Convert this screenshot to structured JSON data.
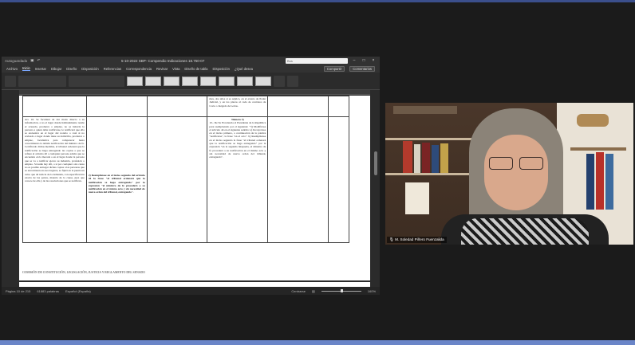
{
  "word": {
    "autosave": "Autoguardado",
    "doc_title": "5-10-2022 SBP- Compendio Indicaciones 18.750-07",
    "search_placeholder": "Bus",
    "menu_tabs": [
      "Archivo",
      "Inicio",
      "Insertar",
      "Dibujar",
      "Diseño",
      "Disposición",
      "Referencias",
      "Correspondencia",
      "Revisar",
      "Vista",
      "Diseño de tabla",
      "Disposición",
      "¿Qué desea"
    ],
    "menu_right": [
      "Compartir",
      "Comentarios"
    ],
    "table": {
      "row1": {
        "c3": "mes, dos años si es séptica, en el evento de Poder Judicial, y en los plazos al cada de contratos de Corte o Juzgado de Letras."
      },
      "row2": {
        "c1": "Art. 16. Se facultará de dar modo directo a su información, a no el lugar donde habitualmente reside el acusado, produzca o emplee, no se haberle la persona a quien debe notificarse, le notificará que ella se encuentra en el lugar del notario o cual si no revisado o lugar donde tiene su domicilio, produzca o emplee, facultativa para comparecer hasta conocimiento la debida notificación del ministro de fe. Certificado dichas medidas, el tribunal ordenará que la notificación se haga entregando las copias a que se refiere el artículo 40 a cualquier persona adulta que se encuentre en la morada o en el lugar donde la persona que se va a notificar ejerce su industria, profesión o empleo. Si nadie hay allí, o si por cualquier otra causa no es posible entregar dichas copias a las personas que se encontraren en esos lugares, se fijará en la puerta un aviso que dé noticia de la demanda, con especificación exacta de las partes, materia de la causa, juez que conoce de ella y de las resoluciones que se notifican.",
        "c2": "2) Reemplázase en el inciso segundo del artículo 44 la frase \"el tribunal ordenará que la notificación se haga entregando\" por la expresión \"el ministro de fe procederá a su notificación en el mismo acto y sin necesidad de nueva orden del tribunal, entregando\".",
        "c3_heading": "Número 3)",
        "c3": "10.- De Su Excelencia el Presidente de la República para reemplazarlo por el siguiente: \"3) Modifícase el artículo 44 en el siguiente sentido: a) Incorpórase en el inciso primero, a continuación de la palabra \"notificarse\", la frase \"en el acto\". b) Reemplázase en el inciso segundo la frase \"el tribunal ordenará que la notificación se haga entregando\" por la expresión \"en la segunda búsqueda, el ministro de fe procederá a su notificación en el mismo acto y sin necesidad de nueva orden del tribunal, entregando\"."
      }
    },
    "footer_note": "COMISIÓN DE CONSTITUCIÓN, LEGISLACIÓN, JUSTICIA Y REGLAMENTO DEL SENADO",
    "status": {
      "page": "Página 10 de 215",
      "words": "61883 palabras",
      "language": "Español (España)",
      "focus": "Centrarse",
      "zoom": "160%"
    }
  },
  "video": {
    "participant_name": "M. Soledad Piñero Fuenzalida"
  }
}
